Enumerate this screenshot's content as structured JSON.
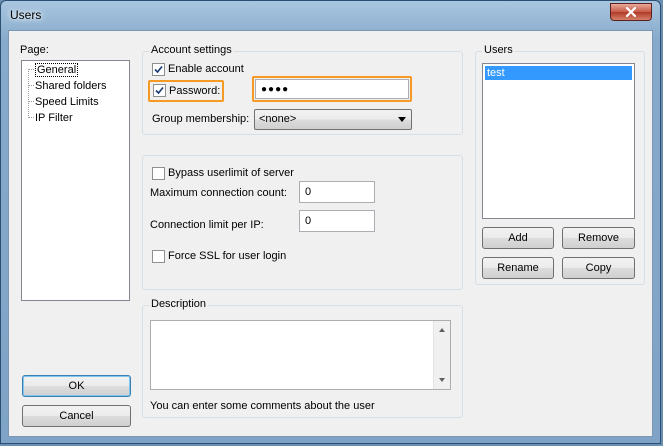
{
  "window": {
    "title": "Users"
  },
  "page_panel": {
    "label": "Page:",
    "items": [
      {
        "label": "General",
        "selected": true
      },
      {
        "label": "Shared folders",
        "selected": false
      },
      {
        "label": "Speed Limits",
        "selected": false
      },
      {
        "label": "IP Filter",
        "selected": false
      }
    ]
  },
  "account_settings": {
    "title": "Account settings",
    "enable_account": {
      "label": "Enable account",
      "checked": true
    },
    "password": {
      "label": "Password:",
      "checked": true,
      "value": "●●●●"
    },
    "group_membership": {
      "label": "Group membership:",
      "value": "<none>"
    }
  },
  "limits": {
    "bypass_userlimit": {
      "label": "Bypass userlimit of server",
      "checked": false
    },
    "max_connections": {
      "label": "Maximum connection count:",
      "value": "0"
    },
    "limit_per_ip": {
      "label": "Connection limit per IP:",
      "value": "0"
    },
    "force_ssl": {
      "label": "Force SSL for user login",
      "checked": false
    }
  },
  "description": {
    "title": "Description",
    "value": "",
    "hint": "You can enter some comments about the user"
  },
  "users_panel": {
    "title": "Users",
    "items": [
      {
        "label": "test",
        "selected": true
      }
    ],
    "add_label": "Add",
    "remove_label": "Remove",
    "rename_label": "Rename",
    "copy_label": "Copy"
  },
  "buttons": {
    "ok_label": "OK",
    "cancel_label": "Cancel"
  },
  "colors": {
    "highlight": "#f59a25",
    "selection": "#3399ff",
    "close_button": "#c75a48"
  }
}
